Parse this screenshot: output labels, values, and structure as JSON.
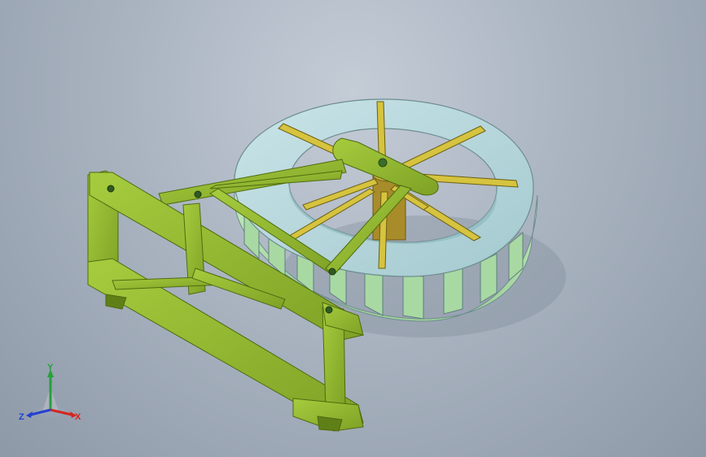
{
  "viewport": {
    "background_top": "#c4ccd6",
    "background_bottom": "#8e99a8"
  },
  "model": {
    "frame_color": "#8fb62e",
    "frame_shadow": "#5f7f17",
    "wheel_color": "#b7d9dd",
    "blade_color": "#b9e0b3",
    "spoke_color": "#c9b63a"
  },
  "triad": {
    "x_label": "X",
    "y_label": "Y",
    "z_label": "Z",
    "x_color": "#d4261f",
    "y_color": "#27a03c",
    "z_color": "#2340d0"
  }
}
